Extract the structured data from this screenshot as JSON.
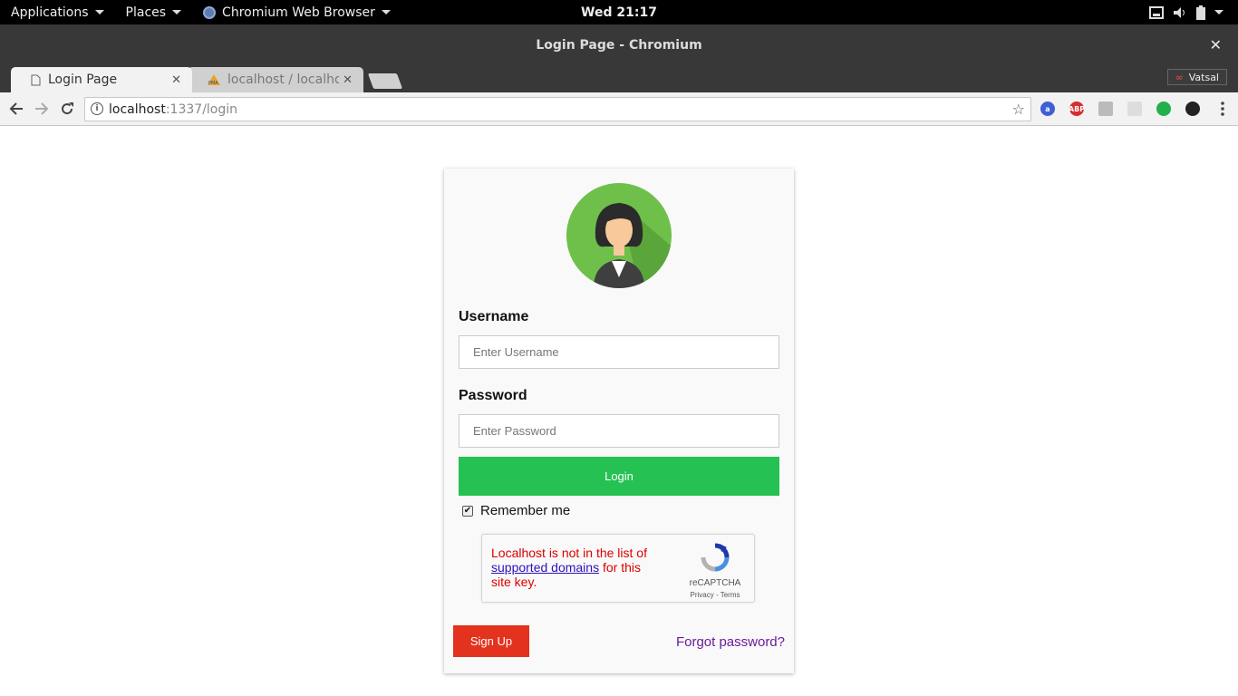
{
  "topbar": {
    "applications": "Applications",
    "places": "Places",
    "app_name": "Chromium Web Browser",
    "clock": "Wed 21:17"
  },
  "window": {
    "title": "Login Page - Chromium"
  },
  "tabs": [
    {
      "label": "Login Page"
    },
    {
      "label": "localhost / localhost"
    }
  ],
  "profile": {
    "name": "Vatsal"
  },
  "omnibox": {
    "host": "localhost",
    "path": ":1337/login"
  },
  "login": {
    "username_label": "Username",
    "username_placeholder": "Enter Username",
    "password_label": "Password",
    "password_placeholder": "Enter Password",
    "login_button": "Login",
    "remember_label": "Remember me",
    "remember_checked": true,
    "recaptcha": {
      "error_prefix": "Localhost is not in the list of ",
      "error_link": "supported domains",
      "error_suffix": " for this site key.",
      "brand": "reCAPTCHA",
      "links": "Privacy - Terms"
    },
    "signup_button": "Sign Up",
    "forgot_link": "Forgot password?"
  },
  "colors": {
    "login_button": "#25c152",
    "signup_button": "#e3321d",
    "avatar_bg": "#6ec04b",
    "error_text": "#dd0000",
    "forgot_link": "#6a1b9a"
  }
}
